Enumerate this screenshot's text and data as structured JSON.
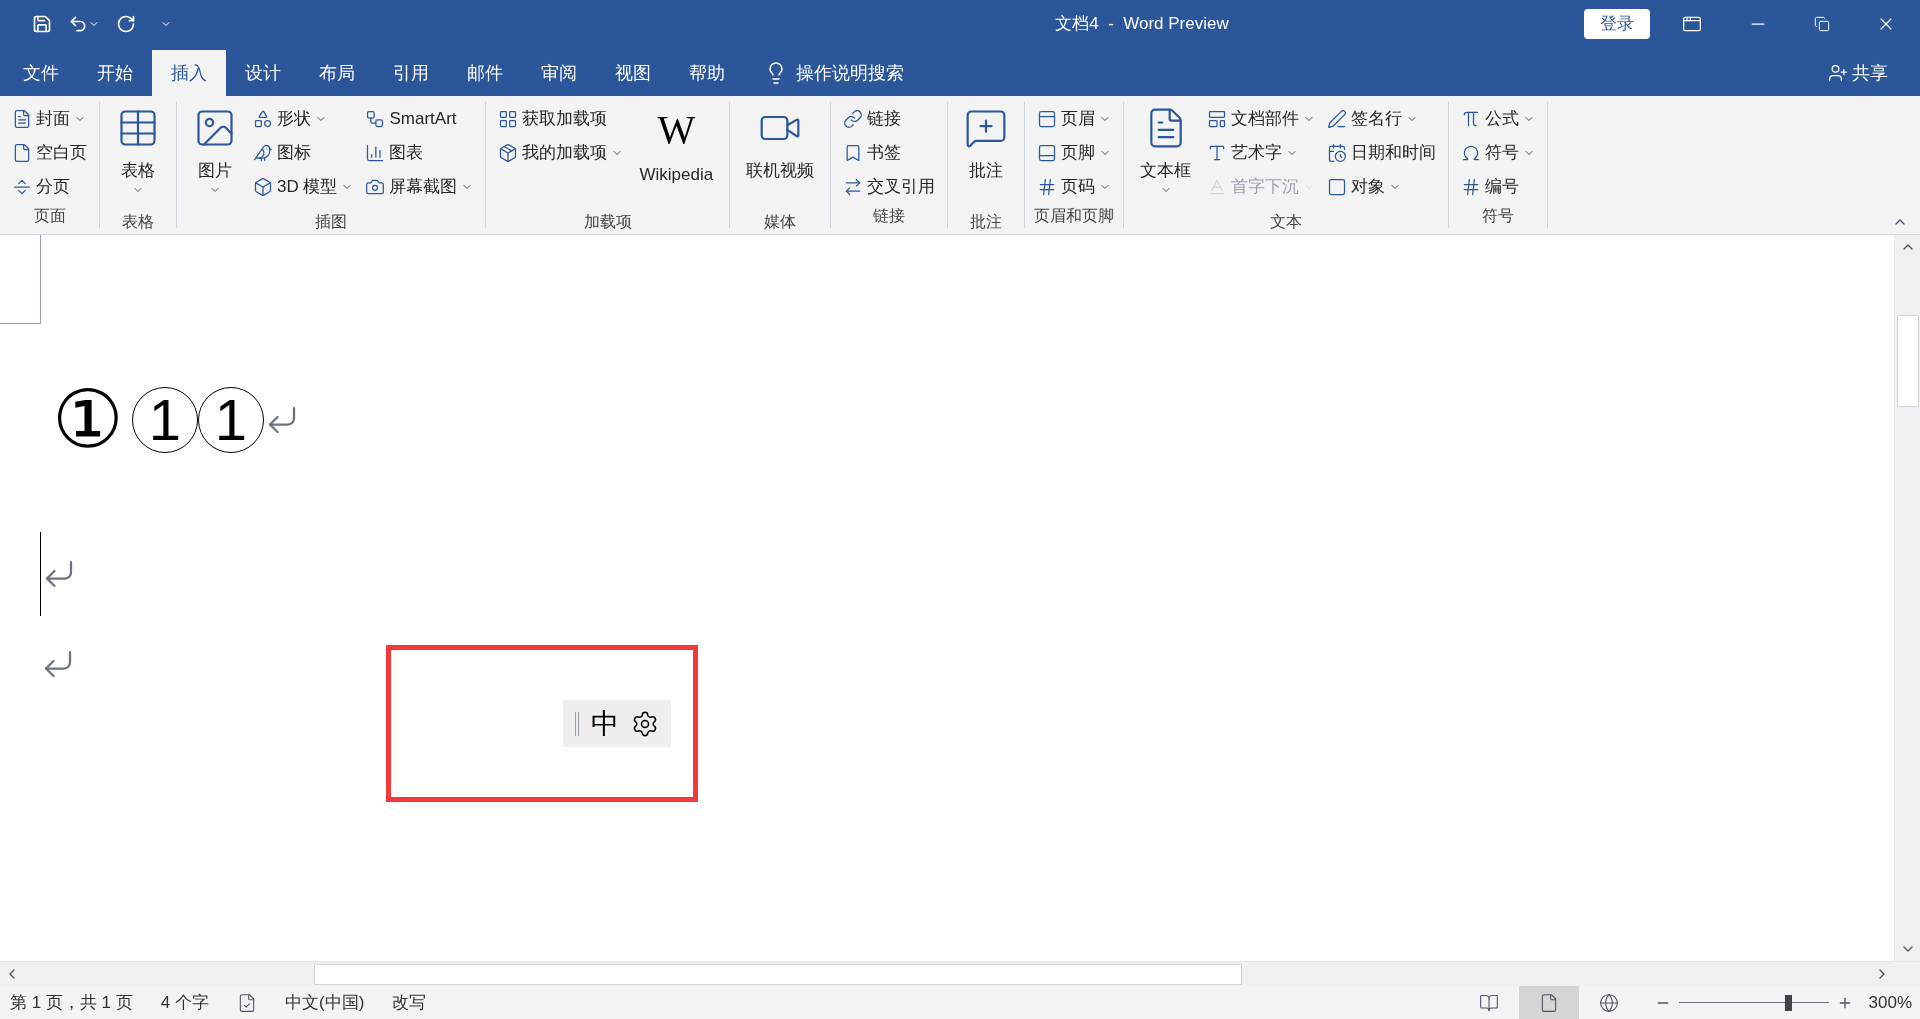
{
  "window": {
    "title": "文档4  -  Word Preview",
    "login": "登录"
  },
  "tabs": [
    {
      "label": "文件",
      "selected": false
    },
    {
      "label": "开始",
      "selected": false
    },
    {
      "label": "插入",
      "selected": true
    },
    {
      "label": "设计",
      "selected": false
    },
    {
      "label": "布局",
      "selected": false
    },
    {
      "label": "引用",
      "selected": false
    },
    {
      "label": "邮件",
      "selected": false
    },
    {
      "label": "审阅",
      "selected": false
    },
    {
      "label": "视图",
      "selected": false
    },
    {
      "label": "帮助",
      "selected": false
    }
  ],
  "search": {
    "placeholder": "操作说明搜索"
  },
  "share": "共享",
  "ribbon": {
    "groups": [
      {
        "label": "页面",
        "columns": [
          [
            {
              "kind": "small",
              "label": "封面",
              "menu": true,
              "disabled": false
            },
            {
              "kind": "small",
              "label": "空白页",
              "menu": false,
              "disabled": false
            },
            {
              "kind": "small",
              "label": "分页",
              "menu": false,
              "disabled": false
            }
          ]
        ]
      },
      {
        "label": "表格",
        "columns": [
          [
            {
              "kind": "large",
              "label": "表格",
              "menu": true,
              "disabled": false
            }
          ]
        ]
      },
      {
        "label": "插图",
        "columns": [
          [
            {
              "kind": "large",
              "label": "图片",
              "menu": true,
              "disabled": false
            }
          ],
          [
            {
              "kind": "small",
              "label": "形状",
              "menu": true,
              "disabled": false
            },
            {
              "kind": "small",
              "label": "图标",
              "menu": false,
              "disabled": false
            },
            {
              "kind": "small",
              "label": "3D 模型",
              "menu": true,
              "disabled": false
            }
          ],
          [
            {
              "kind": "small",
              "label": "SmartArt",
              "menu": false,
              "disabled": false
            },
            {
              "kind": "small",
              "label": "图表",
              "menu": false,
              "disabled": false
            },
            {
              "kind": "small",
              "label": "屏幕截图",
              "menu": true,
              "disabled": false
            }
          ]
        ]
      },
      {
        "label": "加载项",
        "columns": [
          [
            {
              "kind": "small",
              "label": "获取加载项",
              "menu": false,
              "disabled": false
            },
            {
              "kind": "small",
              "label": "我的加载项",
              "menu": true,
              "disabled": false
            }
          ],
          [
            {
              "kind": "large",
              "label": "Wikipedia",
              "logo": "W",
              "menu": false,
              "disabled": false
            }
          ]
        ]
      },
      {
        "label": "媒体",
        "columns": [
          [
            {
              "kind": "large",
              "label": "联机视频",
              "menu": false,
              "disabled": false
            }
          ]
        ]
      },
      {
        "label": "链接",
        "columns": [
          [
            {
              "kind": "small",
              "label": "链接",
              "menu": false,
              "disabled": false
            },
            {
              "kind": "small",
              "label": "书签",
              "menu": false,
              "disabled": false
            },
            {
              "kind": "small",
              "label": "交叉引用",
              "menu": false,
              "disabled": false
            }
          ]
        ]
      },
      {
        "label": "批注",
        "columns": [
          [
            {
              "kind": "large",
              "label": "批注",
              "menu": false,
              "disabled": false
            }
          ]
        ]
      },
      {
        "label": "页眉和页脚",
        "columns": [
          [
            {
              "kind": "small",
              "label": "页眉",
              "menu": true,
              "disabled": false
            },
            {
              "kind": "small",
              "label": "页脚",
              "menu": true,
              "disabled": false
            },
            {
              "kind": "small",
              "label": "页码",
              "menu": true,
              "disabled": false
            }
          ]
        ]
      },
      {
        "label": "文本",
        "columns": [
          [
            {
              "kind": "large",
              "label": "文本框",
              "menu": true,
              "disabled": false
            }
          ],
          [
            {
              "kind": "small",
              "label": "文档部件",
              "menu": true,
              "disabled": false
            },
            {
              "kind": "small",
              "label": "艺术字",
              "menu": true,
              "disabled": false
            },
            {
              "kind": "small",
              "label": "首字下沉",
              "menu": true,
              "disabled": true
            }
          ],
          [
            {
              "kind": "small",
              "label": "签名行",
              "menu": true,
              "disabled": false
            },
            {
              "kind": "small",
              "label": "日期和时间",
              "menu": false,
              "disabled": false
            },
            {
              "kind": "small",
              "label": "对象",
              "menu": true,
              "disabled": false
            }
          ]
        ]
      },
      {
        "label": "符号",
        "columns": [
          [
            {
              "kind": "small",
              "label": "公式",
              "menu": true,
              "disabled": false
            },
            {
              "kind": "small",
              "label": "符号",
              "menu": true,
              "disabled": false
            },
            {
              "kind": "small",
              "label": "编号",
              "menu": false,
              "disabled": false
            }
          ]
        ]
      }
    ]
  },
  "document": {
    "symbol": "①",
    "circled": [
      "1",
      "1"
    ]
  },
  "ime_toolbar": {
    "mode": "中"
  },
  "status_bar": {
    "page": "第 1 页，共 1 页",
    "words": "4 个字",
    "language": "中文(中国)",
    "mode": "改写",
    "views": [
      {
        "kind": "read",
        "selected": false
      },
      {
        "kind": "print",
        "selected": true
      },
      {
        "kind": "web",
        "selected": false
      }
    ],
    "zoom": {
      "level": 0.73,
      "reading": "300%"
    }
  }
}
